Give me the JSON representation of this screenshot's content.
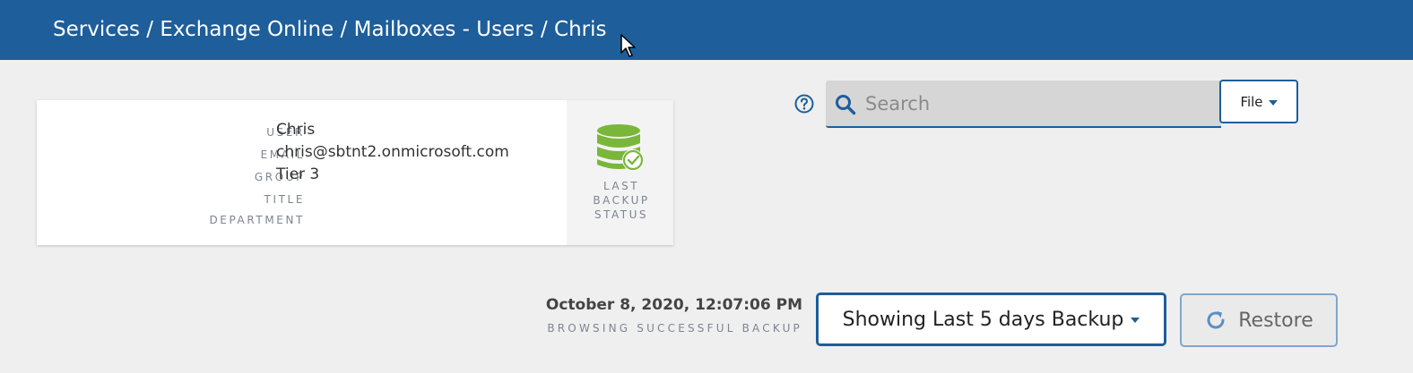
{
  "header": {
    "breadcrumb": "Services / Exchange Online / Mailboxes - Users / Chris"
  },
  "user_card": {
    "labels": {
      "user": "USER",
      "email": "EMAIL",
      "group": "GROUP",
      "title": "TITLE",
      "department": "DEPARTMENT"
    },
    "values": {
      "user": "Chris",
      "email": "chris@sbtnt2.onmicrosoft.com",
      "group": "Tier 3",
      "title": "",
      "department": ""
    },
    "status": {
      "label_line1": "LAST",
      "label_line2": "BACKUP",
      "label_line3": "STATUS",
      "icon": "database-check-icon",
      "icon_color": "#7ab63a"
    }
  },
  "search": {
    "placeholder": "Search",
    "value": ""
  },
  "file_menu": {
    "label": "File"
  },
  "backup": {
    "date": "October 8, 2020, 12:07:06 PM",
    "subtitle": "BROWSING SUCCESSFUL BACKUP",
    "range_label": "Showing Last 5 days Backup",
    "restore_label": "Restore"
  },
  "colors": {
    "brand": "#1d5e9b",
    "success": "#7ab63a",
    "background": "#efefef"
  }
}
